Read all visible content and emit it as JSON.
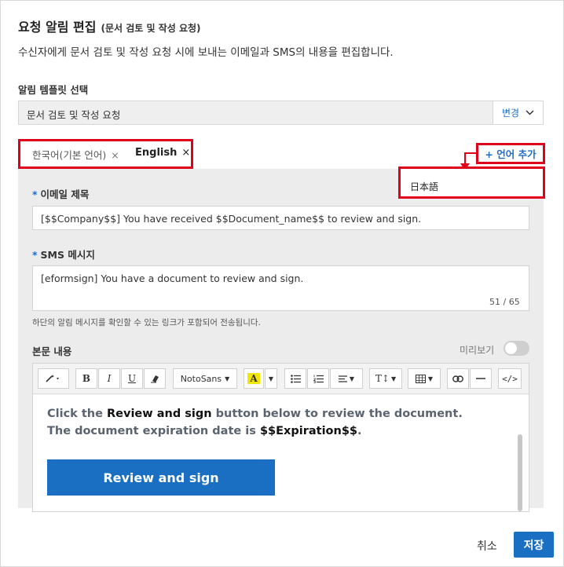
{
  "header": {
    "title": "요청 알림 편집",
    "subtitle": "(문서 검토 및 작성 요청)",
    "description": "수신자에게 문서 검토 및 작성 요청 시에 보내는 이메일과 SMS의 내용을 편집합니다."
  },
  "template": {
    "label": "알림 템플릿 선택",
    "value": "문서 검토 및 작성 요청",
    "change_label": "변경",
    "change_icon": "chevron-down-icon"
  },
  "tabs": [
    {
      "label": "한국어(기본 언어)",
      "close": "×"
    },
    {
      "label": "English",
      "close": "×"
    }
  ],
  "add_language": {
    "label": "+ 언어 추가",
    "options": [
      "日本語"
    ]
  },
  "email_subject": {
    "label": "이메일 제목",
    "value": "[$$Company$$] You have received $$Document_name$$ to review and sign."
  },
  "sms": {
    "label": "SMS 메시지",
    "value": "[eformsign] You have a document to review and sign.",
    "count": "51 / 65",
    "hint": "하단의 알림 메시지를 확인할 수 있는 링크가 포함되어 전송됩니다."
  },
  "body": {
    "label": "본문 내용",
    "preview_label": "미리보기",
    "preview_on": false,
    "toolbar": {
      "font": "NotoSans",
      "bold": "B",
      "italic": "I",
      "underline": "U",
      "font_color": "A",
      "text_size": "T↕",
      "code": "</>"
    },
    "content": {
      "line1_a": "Click the ",
      "line1_b": "Review and sign",
      "line1_c": " button below to review the document.",
      "line2_a": "The document expiration date is ",
      "line2_b": "$$Expiration$$",
      "line2_c": ".",
      "button": "Review and sign"
    }
  },
  "footer": {
    "cancel": "취소",
    "save": "저장"
  },
  "colors": {
    "accent": "#1a6fc2",
    "highlight": "#e0001b",
    "panel": "#ececec"
  }
}
